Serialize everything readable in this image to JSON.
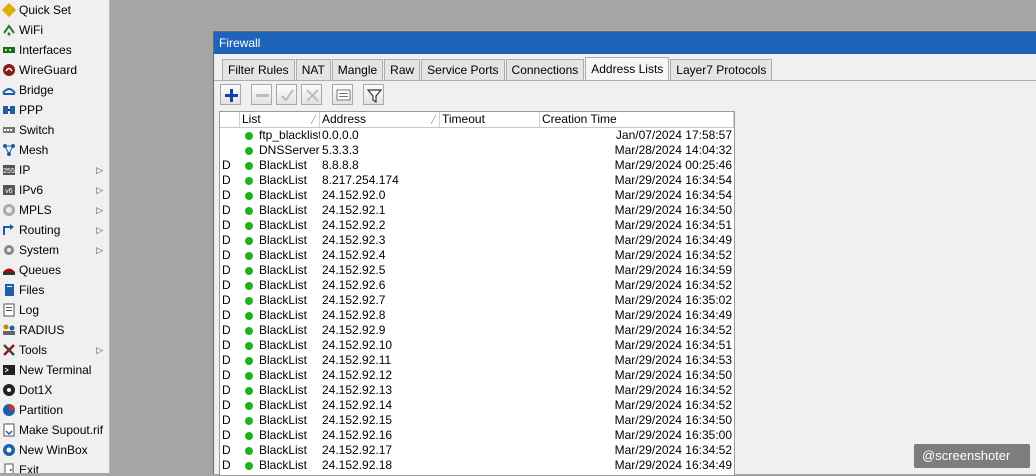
{
  "sidebar": {
    "items": [
      {
        "label": "Quick Set",
        "icon": "quick-set-icon",
        "submenu": false
      },
      {
        "label": "WiFi",
        "icon": "wifi-icon",
        "submenu": false
      },
      {
        "label": "Interfaces",
        "icon": "interfaces-icon",
        "submenu": false
      },
      {
        "label": "WireGuard",
        "icon": "wireguard-icon",
        "submenu": false
      },
      {
        "label": "Bridge",
        "icon": "bridge-icon",
        "submenu": false
      },
      {
        "label": "PPP",
        "icon": "ppp-icon",
        "submenu": false
      },
      {
        "label": "Switch",
        "icon": "switch-icon",
        "submenu": false
      },
      {
        "label": "Mesh",
        "icon": "mesh-icon",
        "submenu": false
      },
      {
        "label": "IP",
        "icon": "ip-icon",
        "submenu": true
      },
      {
        "label": "IPv6",
        "icon": "ipv6-icon",
        "submenu": true
      },
      {
        "label": "MPLS",
        "icon": "mpls-icon",
        "submenu": true
      },
      {
        "label": "Routing",
        "icon": "routing-icon",
        "submenu": true
      },
      {
        "label": "System",
        "icon": "system-icon",
        "submenu": true
      },
      {
        "label": "Queues",
        "icon": "queues-icon",
        "submenu": false
      },
      {
        "label": "Files",
        "icon": "files-icon",
        "submenu": false
      },
      {
        "label": "Log",
        "icon": "log-icon",
        "submenu": false
      },
      {
        "label": "RADIUS",
        "icon": "radius-icon",
        "submenu": false
      },
      {
        "label": "Tools",
        "icon": "tools-icon",
        "submenu": true
      },
      {
        "label": "New Terminal",
        "icon": "terminal-icon",
        "submenu": false
      },
      {
        "label": "Dot1X",
        "icon": "dot1x-icon",
        "submenu": false
      },
      {
        "label": "Partition",
        "icon": "partition-icon",
        "submenu": false
      },
      {
        "label": "Make Supout.rif",
        "icon": "supout-icon",
        "submenu": false
      },
      {
        "label": "New WinBox",
        "icon": "winbox-icon",
        "submenu": false
      },
      {
        "label": "Exit",
        "icon": "exit-icon",
        "submenu": false
      }
    ]
  },
  "window": {
    "title": "Firewall",
    "tabs": [
      {
        "label": "Filter Rules",
        "active": false
      },
      {
        "label": "NAT",
        "active": false
      },
      {
        "label": "Mangle",
        "active": false
      },
      {
        "label": "Raw",
        "active": false
      },
      {
        "label": "Service Ports",
        "active": false
      },
      {
        "label": "Connections",
        "active": false
      },
      {
        "label": "Address Lists",
        "active": true
      },
      {
        "label": "Layer7 Protocols",
        "active": false
      }
    ],
    "toolbar": [
      "add-icon",
      "remove-icon",
      "enable-icon",
      "disable-icon",
      "comment-icon",
      "filter-icon"
    ],
    "table": {
      "columns": [
        "",
        "List",
        "Address",
        "Timeout",
        "Creation Time"
      ],
      "rows": [
        {
          "flag": "",
          "list": "ftp_blacklist",
          "address": "0.0.0.0",
          "timeout": "",
          "created": "Jan/07/2024 17:58:57"
        },
        {
          "flag": "",
          "list": "DNSServers",
          "address": "5.3.3.3",
          "timeout": "",
          "created": "Mar/28/2024 14:04:32"
        },
        {
          "flag": "D",
          "list": "BlackList",
          "address": "8.8.8.8",
          "timeout": "",
          "created": "Mar/29/2024 00:25:46"
        },
        {
          "flag": "D",
          "list": "BlackList",
          "address": "8.217.254.174",
          "timeout": "",
          "created": "Mar/29/2024 16:34:54"
        },
        {
          "flag": "D",
          "list": "BlackList",
          "address": "24.152.92.0",
          "timeout": "",
          "created": "Mar/29/2024 16:34:54"
        },
        {
          "flag": "D",
          "list": "BlackList",
          "address": "24.152.92.1",
          "timeout": "",
          "created": "Mar/29/2024 16:34:50"
        },
        {
          "flag": "D",
          "list": "BlackList",
          "address": "24.152.92.2",
          "timeout": "",
          "created": "Mar/29/2024 16:34:51"
        },
        {
          "flag": "D",
          "list": "BlackList",
          "address": "24.152.92.3",
          "timeout": "",
          "created": "Mar/29/2024 16:34:49"
        },
        {
          "flag": "D",
          "list": "BlackList",
          "address": "24.152.92.4",
          "timeout": "",
          "created": "Mar/29/2024 16:34:52"
        },
        {
          "flag": "D",
          "list": "BlackList",
          "address": "24.152.92.5",
          "timeout": "",
          "created": "Mar/29/2024 16:34:59"
        },
        {
          "flag": "D",
          "list": "BlackList",
          "address": "24.152.92.6",
          "timeout": "",
          "created": "Mar/29/2024 16:34:52"
        },
        {
          "flag": "D",
          "list": "BlackList",
          "address": "24.152.92.7",
          "timeout": "",
          "created": "Mar/29/2024 16:35:02"
        },
        {
          "flag": "D",
          "list": "BlackList",
          "address": "24.152.92.8",
          "timeout": "",
          "created": "Mar/29/2024 16:34:49"
        },
        {
          "flag": "D",
          "list": "BlackList",
          "address": "24.152.92.9",
          "timeout": "",
          "created": "Mar/29/2024 16:34:52"
        },
        {
          "flag": "D",
          "list": "BlackList",
          "address": "24.152.92.10",
          "timeout": "",
          "created": "Mar/29/2024 16:34:51"
        },
        {
          "flag": "D",
          "list": "BlackList",
          "address": "24.152.92.11",
          "timeout": "",
          "created": "Mar/29/2024 16:34:53"
        },
        {
          "flag": "D",
          "list": "BlackList",
          "address": "24.152.92.12",
          "timeout": "",
          "created": "Mar/29/2024 16:34:50"
        },
        {
          "flag": "D",
          "list": "BlackList",
          "address": "24.152.92.13",
          "timeout": "",
          "created": "Mar/29/2024 16:34:52"
        },
        {
          "flag": "D",
          "list": "BlackList",
          "address": "24.152.92.14",
          "timeout": "",
          "created": "Mar/29/2024 16:34:52"
        },
        {
          "flag": "D",
          "list": "BlackList",
          "address": "24.152.92.15",
          "timeout": "",
          "created": "Mar/29/2024 16:34:50"
        },
        {
          "flag": "D",
          "list": "BlackList",
          "address": "24.152.92.16",
          "timeout": "",
          "created": "Mar/29/2024 16:35:00"
        },
        {
          "flag": "D",
          "list": "BlackList",
          "address": "24.152.92.17",
          "timeout": "",
          "created": "Mar/29/2024 16:34:52"
        },
        {
          "flag": "D",
          "list": "BlackList",
          "address": "24.152.92.18",
          "timeout": "",
          "created": "Mar/29/2024 16:34:49"
        }
      ]
    }
  },
  "watermark": {
    "text": "@screenshoter"
  },
  "colors": {
    "titlebar": "#1f64b8",
    "enabled_dot": "#1cb21c",
    "desktop": "#a5a5a5"
  }
}
